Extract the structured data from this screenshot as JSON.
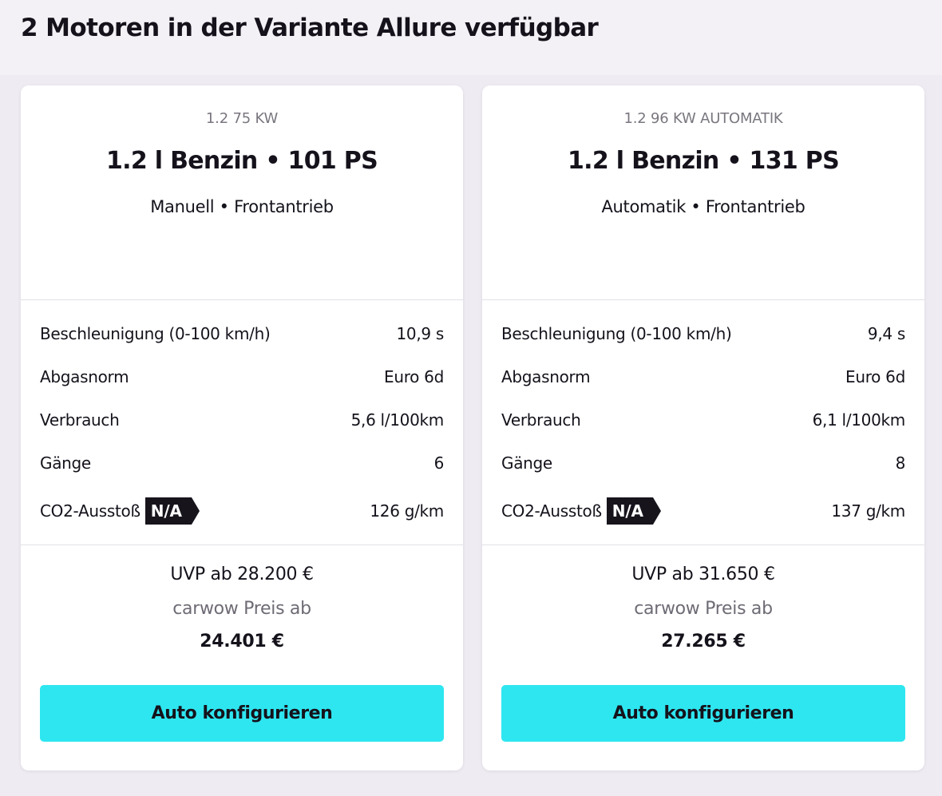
{
  "heading": "2 Motoren in der Variante Allure verfügbar",
  "colors": {
    "page_background": "#f4f1f6",
    "card_background": "#ffffff",
    "button_accent": "#2ee6f0",
    "badge_background": "#17141c",
    "muted_text": "#7a767f"
  },
  "engines": [
    {
      "code": "1.2 75 KW",
      "title": "1.2 l Benzin • 101 PS",
      "subtitle": "Manuell • Frontantrieb",
      "specs": [
        {
          "label": "Beschleunigung (0-100 km/h)",
          "value": "10,9 s"
        },
        {
          "label": "Abgasnorm",
          "value": "Euro 6d"
        },
        {
          "label": "Verbrauch",
          "value": "5,6 l/100km"
        },
        {
          "label": "Gänge",
          "value": "6"
        },
        {
          "label": "CO2-Ausstoß",
          "badge": "N/A",
          "value": "126 g/km"
        }
      ],
      "uvp": "UVP ab 28.200 €",
      "carwow_label": "carwow Preis ab",
      "carwow_price": "24.401 €",
      "cta": "Auto konfigurieren"
    },
    {
      "code": "1.2 96 KW AUTOMATIK",
      "title": "1.2 l Benzin • 131 PS",
      "subtitle": "Automatik • Frontantrieb",
      "specs": [
        {
          "label": "Beschleunigung (0-100 km/h)",
          "value": "9,4 s"
        },
        {
          "label": "Abgasnorm",
          "value": "Euro 6d"
        },
        {
          "label": "Verbrauch",
          "value": "6,1 l/100km"
        },
        {
          "label": "Gänge",
          "value": "8"
        },
        {
          "label": "CO2-Ausstoß",
          "badge": "N/A",
          "value": "137 g/km"
        }
      ],
      "uvp": "UVP ab 31.650 €",
      "carwow_label": "carwow Preis ab",
      "carwow_price": "27.265 €",
      "cta": "Auto konfigurieren"
    }
  ]
}
